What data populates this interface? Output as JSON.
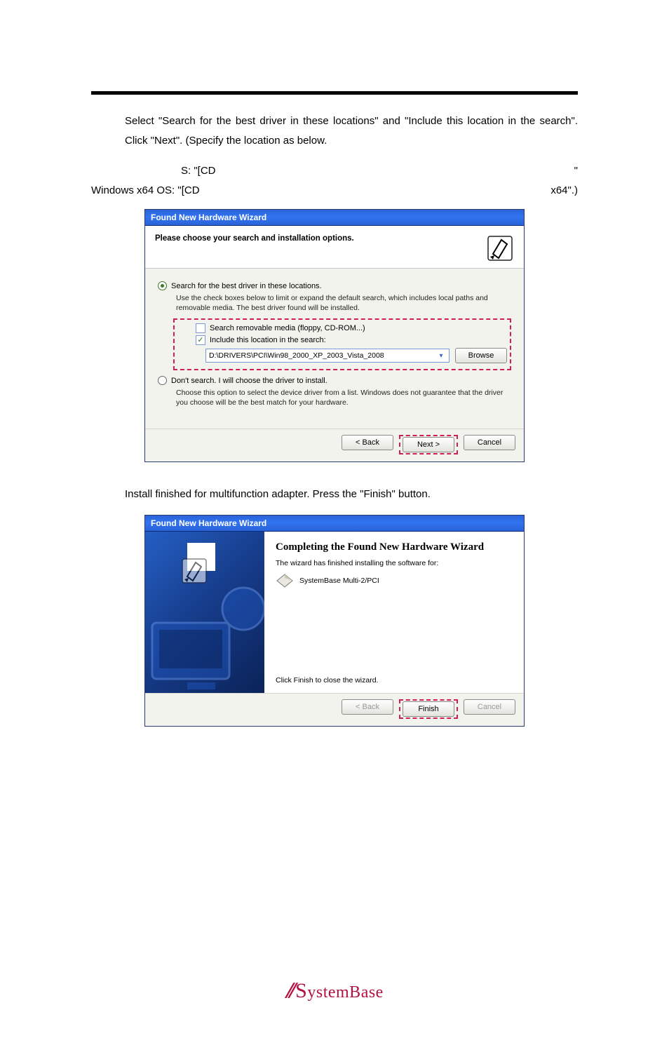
{
  "body": {
    "line1": "Select \"Search for the best driver in these locations\" and \"Include this location in the search\". Click \"Next\". (Specify the location as below.",
    "line2_left": "S: \"[CD",
    "line2_right": "\"",
    "line3_left": "Windows x64 OS: \"[CD",
    "line3_right": "x64\".)",
    "line4": "Install finished for multifunction adapter. Press the \"Finish\" button."
  },
  "wizard1": {
    "title": "Found New Hardware Wizard",
    "heading": "Please choose your search and installation options.",
    "opt1": "Search for the best driver in these locations.",
    "opt1_desc": "Use the check boxes below to limit or expand the default search, which includes local paths and removable media. The best driver found will be installed.",
    "chk1": "Search removable media (floppy, CD-ROM...)",
    "chk2": "Include this location in the search:",
    "path": "D:\\DRIVERS\\PCI\\Win98_2000_XP_2003_Vista_2008",
    "browse": "Browse",
    "opt2": "Don't search. I will choose the driver to install.",
    "opt2_desc": "Choose this option to select the device driver from a list.  Windows does not guarantee that the driver you choose will be the best match for your hardware.",
    "back": "< Back",
    "next": "Next >",
    "cancel": "Cancel"
  },
  "wizard2": {
    "title": "Found New Hardware Wizard",
    "heading": "Completing the Found New Hardware Wizard",
    "sub": "The wizard has finished installing the software for:",
    "device": "SystemBase Multi-2/PCI",
    "tip": "Click Finish to close the wizard.",
    "back": "< Back",
    "finish": "Finish",
    "cancel": "Cancel"
  },
  "footer": {
    "logo": "SystemBase"
  }
}
